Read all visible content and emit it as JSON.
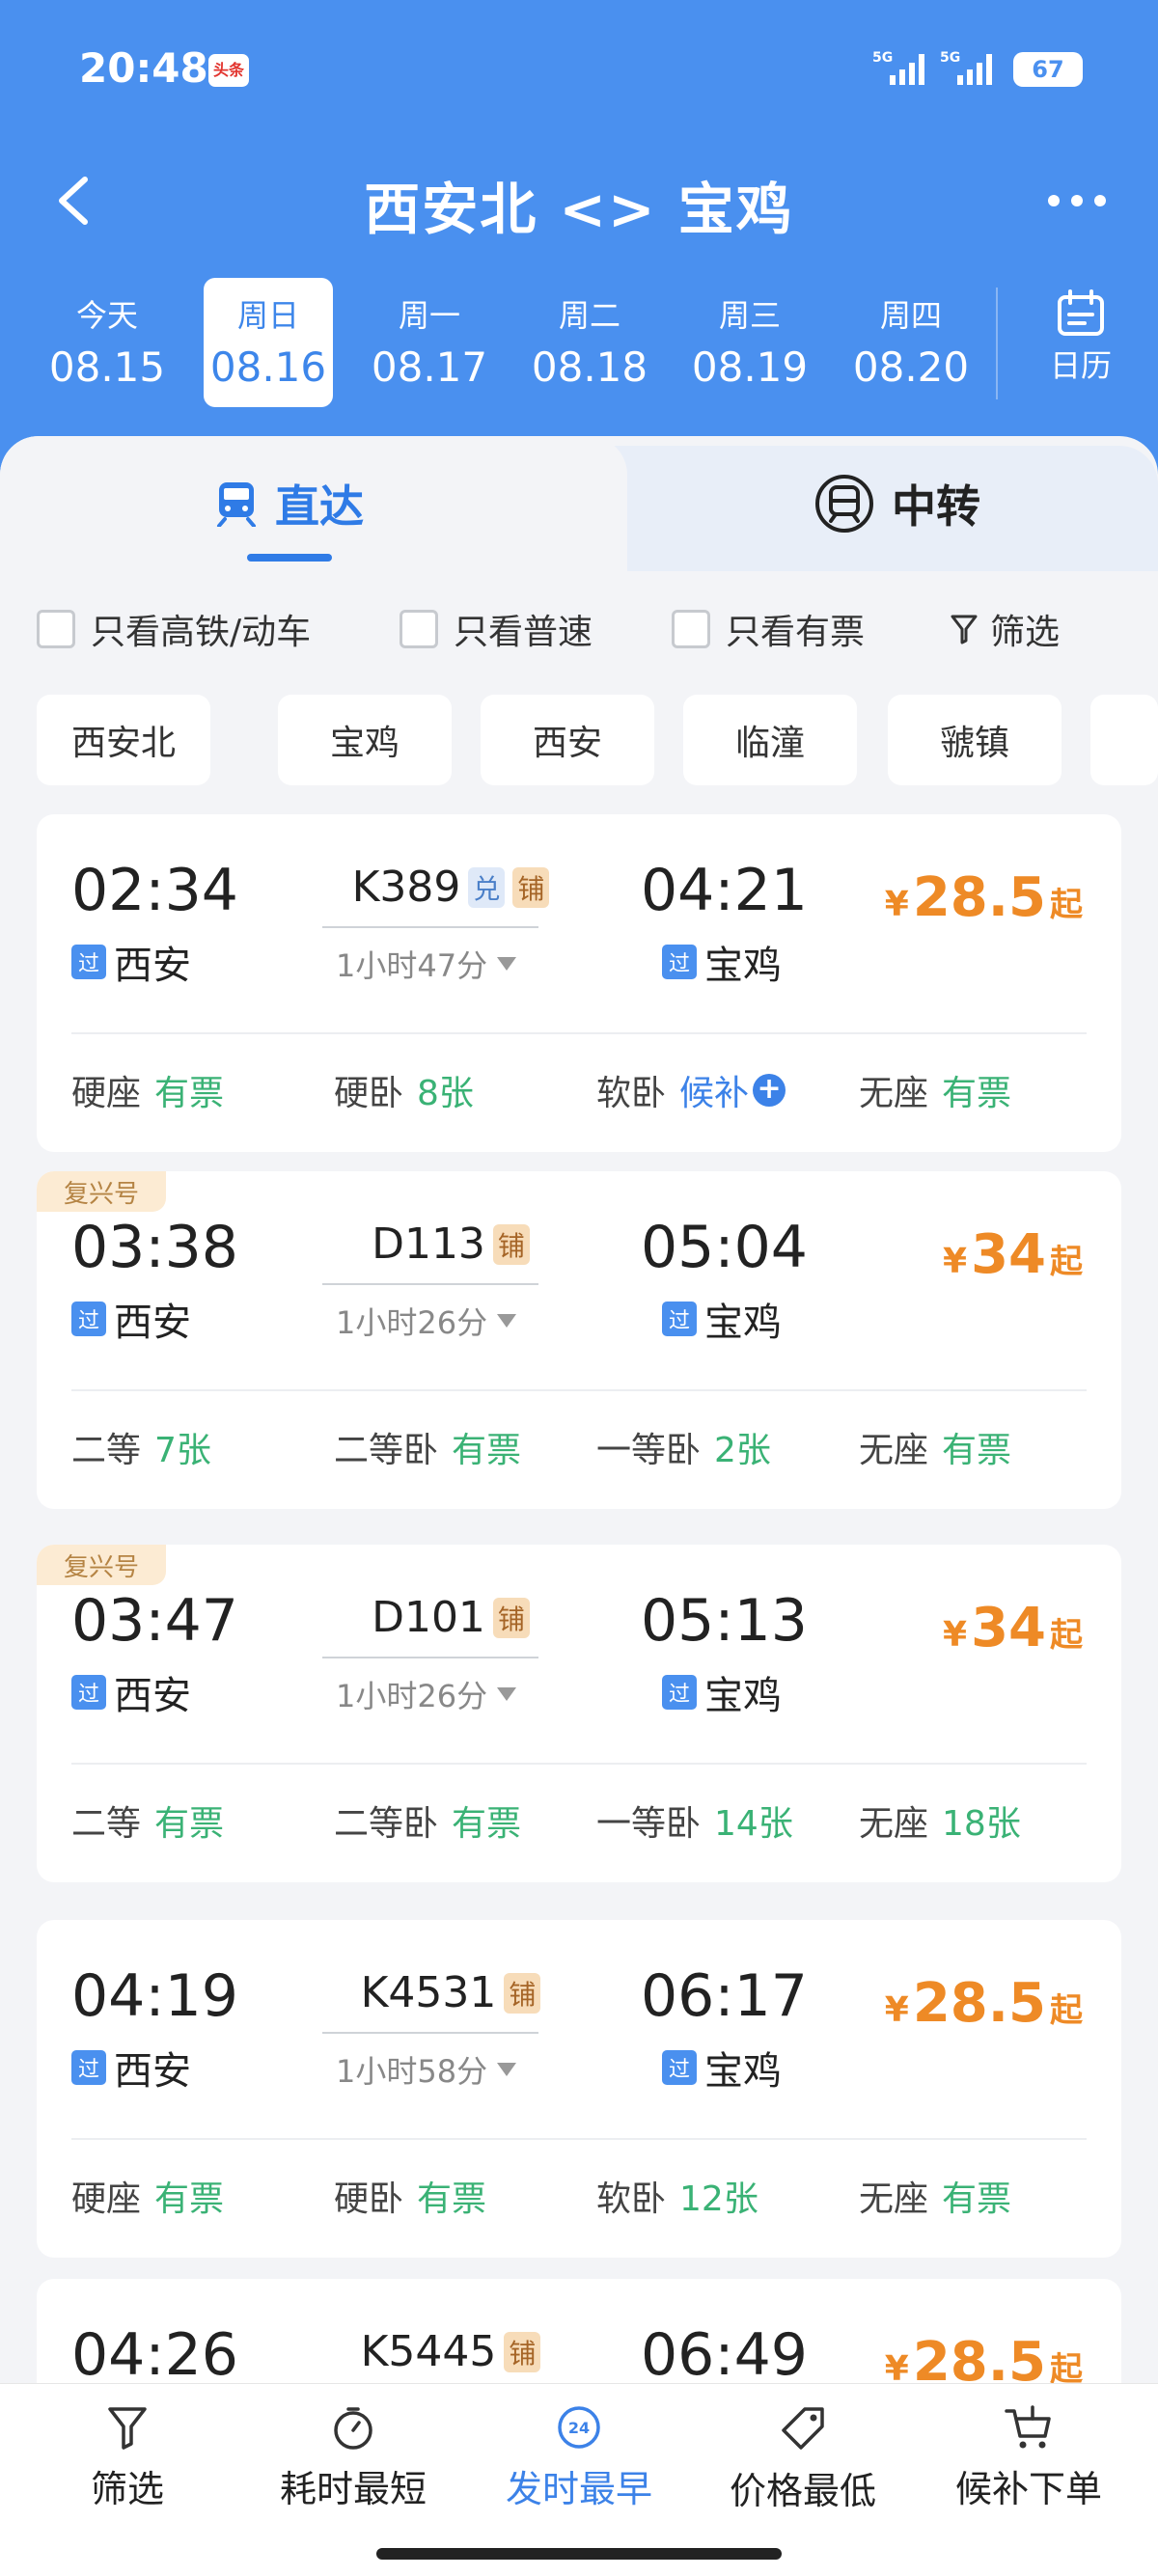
{
  "status_bar": {
    "time": "20:48",
    "app_badge": "头条",
    "signal1": "5G",
    "signal2": "5G",
    "battery": "67"
  },
  "header": {
    "title": "西安北 <> 宝鸡"
  },
  "dates": [
    {
      "week": "今天",
      "date": "08.15"
    },
    {
      "week": "周日",
      "date": "08.16"
    },
    {
      "week": "周一",
      "date": "08.17"
    },
    {
      "week": "周二",
      "date": "08.18"
    },
    {
      "week": "周三",
      "date": "08.19"
    },
    {
      "week": "周四",
      "date": "08.20"
    }
  ],
  "calendar_label": "日历",
  "tabs": {
    "direct": "直达",
    "transfer": "中转"
  },
  "filters": {
    "high_speed": "只看高铁/动车",
    "normal": "只看普速",
    "available": "只看有票",
    "filter": "筛选"
  },
  "stations": [
    "西安北",
    "宝鸡",
    "西安",
    "临潼",
    "虢镇"
  ],
  "trains": [
    {
      "badge": "",
      "dep_time": "02:34",
      "dep_station": "西安",
      "dep_via": "过",
      "train_no": "K389",
      "tags": [
        "兑",
        "铺"
      ],
      "duration": "1小时47分",
      "arr_time": "04:21",
      "arr_station": "宝鸡",
      "arr_via": "过",
      "price_symbol": "¥",
      "price": "28.5",
      "price_suffix": "起",
      "seats": [
        {
          "type": "硬座",
          "value": "有票"
        },
        {
          "type": "硬卧",
          "value": "8张"
        },
        {
          "type": "软卧",
          "value": "候补"
        },
        {
          "type": "无座",
          "value": "有票"
        }
      ]
    },
    {
      "badge": "复兴号",
      "dep_time": "03:38",
      "dep_station": "西安",
      "dep_via": "过",
      "train_no": "D113",
      "tags": [
        "铺"
      ],
      "duration": "1小时26分",
      "arr_time": "05:04",
      "arr_station": "宝鸡",
      "arr_via": "过",
      "price_symbol": "¥",
      "price": "34",
      "price_suffix": "起",
      "seats": [
        {
          "type": "二等",
          "value": "7张"
        },
        {
          "type": "二等卧",
          "value": "有票"
        },
        {
          "type": "一等卧",
          "value": "2张"
        },
        {
          "type": "无座",
          "value": "有票"
        }
      ]
    },
    {
      "badge": "复兴号",
      "dep_time": "03:47",
      "dep_station": "西安",
      "dep_via": "过",
      "train_no": "D101",
      "tags": [
        "铺"
      ],
      "duration": "1小时26分",
      "arr_time": "05:13",
      "arr_station": "宝鸡",
      "arr_via": "过",
      "price_symbol": "¥",
      "price": "34",
      "price_suffix": "起",
      "seats": [
        {
          "type": "二等",
          "value": "有票"
        },
        {
          "type": "二等卧",
          "value": "有票"
        },
        {
          "type": "一等卧",
          "value": "14张"
        },
        {
          "type": "无座",
          "value": "18张"
        }
      ]
    },
    {
      "badge": "",
      "dep_time": "04:19",
      "dep_station": "西安",
      "dep_via": "过",
      "train_no": "K4531",
      "tags": [
        "铺"
      ],
      "duration": "1小时58分",
      "arr_time": "06:17",
      "arr_station": "宝鸡",
      "arr_via": "过",
      "price_symbol": "¥",
      "price": "28.5",
      "price_suffix": "起",
      "seats": [
        {
          "type": "硬座",
          "value": "有票"
        },
        {
          "type": "硬卧",
          "value": "有票"
        },
        {
          "type": "软卧",
          "value": "12张"
        },
        {
          "type": "无座",
          "value": "有票"
        }
      ]
    },
    {
      "badge": "",
      "dep_time": "04:26",
      "dep_station": "",
      "dep_via": "",
      "train_no": "K5445",
      "tags": [
        "铺"
      ],
      "duration": "",
      "arr_time": "06:49",
      "arr_station": "",
      "arr_via": "",
      "price_symbol": "¥",
      "price": "28.5",
      "price_suffix": "起",
      "seats": []
    }
  ],
  "bottom_bar": {
    "filter": "筛选",
    "shortest": "耗时最短",
    "badge_24": "24",
    "earliest": "发时最早",
    "cheapest": "价格最低",
    "waitlist": "候补下单"
  },
  "colors": {
    "header_blue": "#4a90ef",
    "accent_blue": "#3c82e8",
    "price_orange": "#ee8a26",
    "ticket_green": "#3ab275"
  }
}
